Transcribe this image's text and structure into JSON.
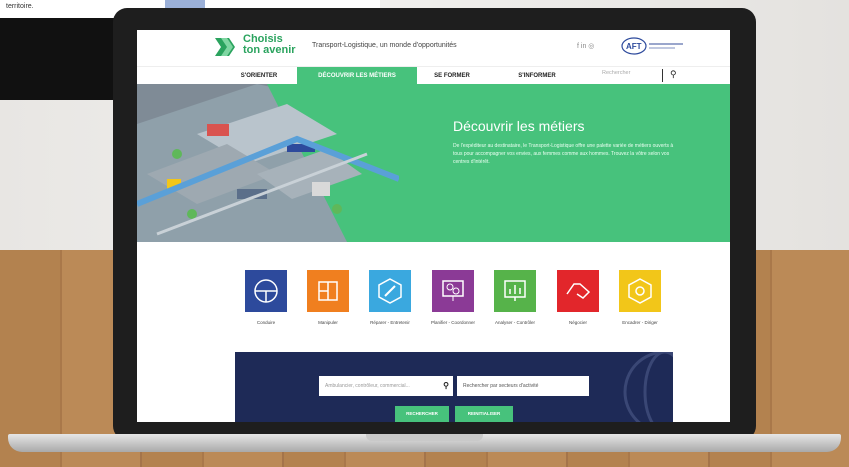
{
  "background": {
    "monitor_text": "territoire."
  },
  "header": {
    "logo_line1": "Choisis",
    "logo_line2": "ton avenir",
    "tagline": "Transport-Logistique, un monde d'opportunités",
    "social": "f  in  ◎"
  },
  "nav": {
    "items": [
      {
        "label": "S'ORIENTER"
      },
      {
        "label": "DÉCOUVRIR LES MÉTIERS"
      },
      {
        "label": "SE FORMER"
      },
      {
        "label": "S'INFORMER"
      }
    ],
    "search_placeholder": "Rechercher"
  },
  "hero": {
    "title": "Découvrir les métiers",
    "text": "De l'expéditeur au ‎destinataire, le Transport-Logistique offre une palette variée de métiers ouverts à tous pour accompagner vos envies, aux femmes comme aux hommes. Trouvez la vôtre selon vos centres d'intérêt."
  },
  "categories": [
    {
      "label": "Conduire",
      "color": "#2d4a9c",
      "icon": "steering-wheel-icon"
    },
    {
      "label": "Manipuler",
      "color": "#f07f1f",
      "icon": "boxes-icon"
    },
    {
      "label": "Réparer - Entretenir",
      "color": "#3aa8df",
      "icon": "wrench-icon"
    },
    {
      "label": "Planifier - Coordonner",
      "color": "#8b3a96",
      "icon": "planning-icon"
    },
    {
      "label": "Analyser - Contrôler",
      "color": "#56b34a",
      "icon": "chart-icon"
    },
    {
      "label": "Négocier",
      "color": "#e2262b",
      "icon": "handshake-icon"
    },
    {
      "label": "Encadrer - Diriger",
      "color": "#f2c619",
      "icon": "target-icon"
    }
  ],
  "search": {
    "keyword_placeholder": "Ambulancier, contrôleur, commercial...",
    "establishment_placeholder": "Rechercher par secteurs d'activité",
    "search_button": "RECHERCHER",
    "reset_button": "REINITIALISER"
  }
}
